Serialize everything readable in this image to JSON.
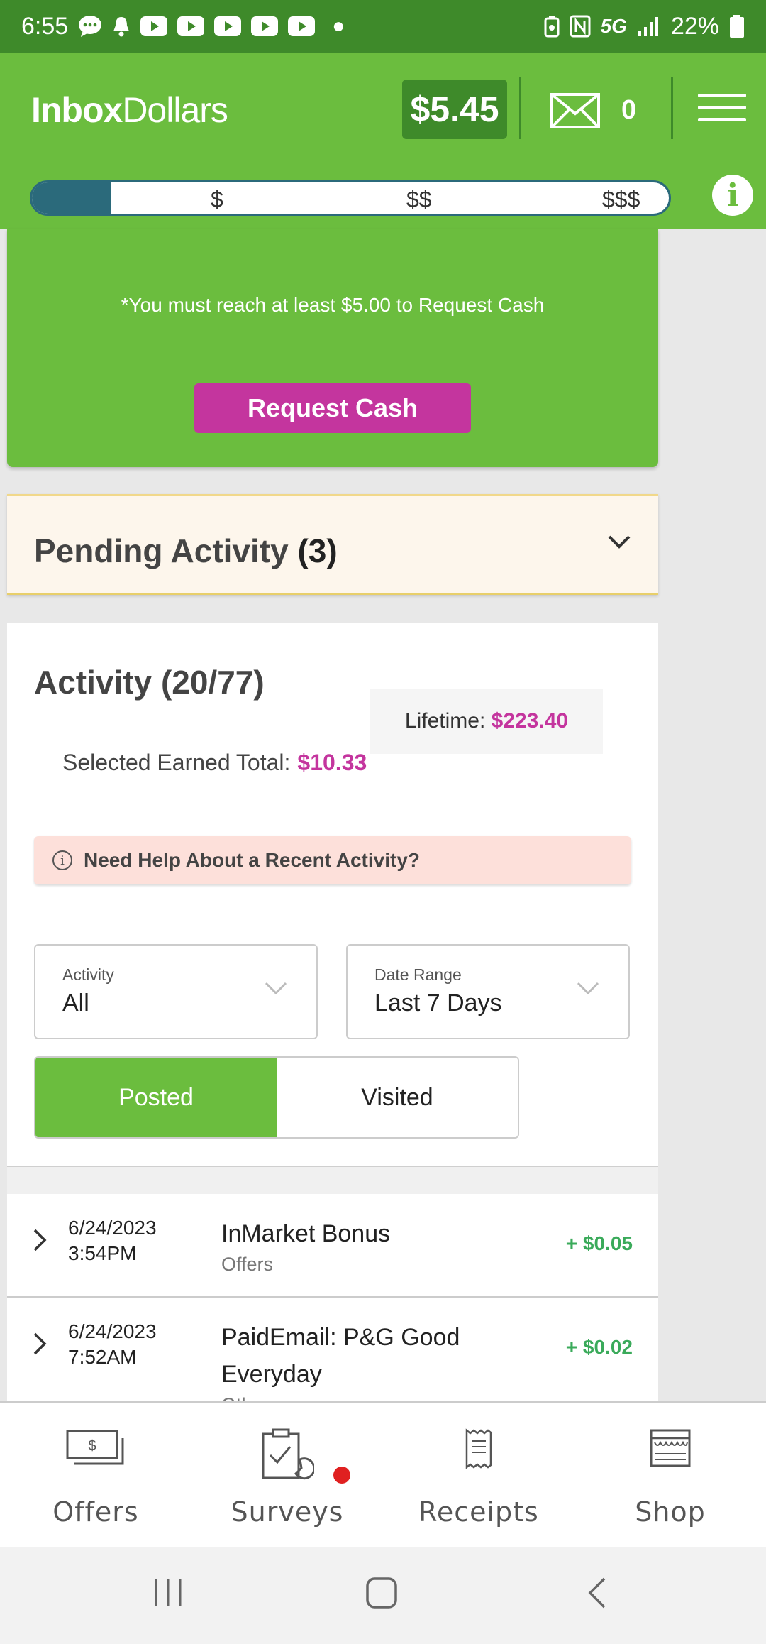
{
  "status_bar": {
    "time": "6:55",
    "network": "5G",
    "battery": "22%"
  },
  "header": {
    "logo_part1": "Inbox",
    "logo_part2": "Dollars",
    "balance": "$5.45",
    "mail_count": "0",
    "progress_ticks": [
      "$",
      "$$",
      "$$$"
    ],
    "progress_fraction": 0.125,
    "info_glyph": "i"
  },
  "cash": {
    "note": "*You must reach at least $5.00 to Request Cash",
    "button_label": "Request Cash"
  },
  "pending": {
    "label": "Pending Activity",
    "count": "(3)"
  },
  "activity": {
    "title": "Activity (20/77)",
    "lifetime_label": "Lifetime:",
    "lifetime_value": "$223.40",
    "selected_label": "Selected Earned Total:",
    "selected_value": "$10.33",
    "help_text": "Need Help About a Recent Activity?",
    "filter_activity_label": "Activity",
    "filter_activity_value": "All",
    "filter_date_label": "Date Range",
    "filter_date_value": "Last 7 Days",
    "toggle_posted": "Posted",
    "toggle_visited": "Visited",
    "rows": [
      {
        "date": "6/24/2023",
        "time": "3:54PM",
        "name": "InMarket Bonus",
        "category": "Offers",
        "amount": "+ $0.05"
      },
      {
        "date": "6/24/2023",
        "time": "7:52AM",
        "name": "PaidEmail: P&G Good Everyday",
        "category": "Other",
        "amount": "+ $0.02"
      }
    ]
  },
  "bottom_nav": {
    "items": [
      {
        "label": "Offers",
        "icon": "cash-icon"
      },
      {
        "label": "Surveys",
        "icon": "clipboard-icon"
      },
      {
        "label": "Receipts",
        "icon": "receipt-icon"
      },
      {
        "label": "Shop",
        "icon": "shop-icon"
      }
    ]
  },
  "colors": {
    "brand_green": "#6bbd3e",
    "dark_green": "#3e8a2a",
    "accent_pink": "#c4359e",
    "progress_teal": "#2b6a7b",
    "amount_green": "#3aaa5a"
  }
}
